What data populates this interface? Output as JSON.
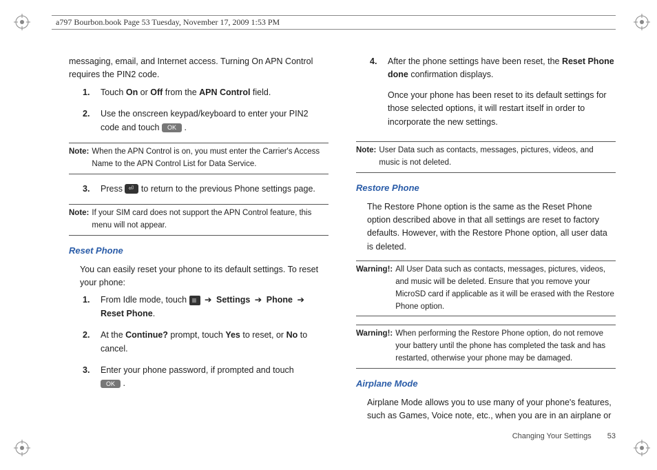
{
  "header": "a797 Bourbon.book  Page 53  Tuesday, November 17, 2009  1:53 PM",
  "left": {
    "intro": "messaging, email, and Internet access. Turning On APN Control requires the PIN2 code.",
    "steps_a": [
      {
        "n": "1.",
        "pre": "Touch ",
        "b1": "On",
        "mid": " or ",
        "b2": "Off",
        "mid2": " from the ",
        "b3": "APN Control",
        "post": " field."
      },
      {
        "n": "2.",
        "text": "Use the onscreen keypad/keyboard to enter your PIN2 code and touch ",
        "ok": "OK"
      }
    ],
    "note1": {
      "label": "Note:",
      "text": "When the APN Control is on, you must enter the Carrier's Access Name to the APN Control List for Data Service."
    },
    "step3": {
      "n": "3.",
      "pre": "Press ",
      "post": " to return to the previous Phone settings page."
    },
    "note2": {
      "label": "Note:",
      "text": "If your SIM card does not support the APN Control feature, this menu will not appear."
    },
    "h_reset": "Reset Phone",
    "reset_intro": "You can easily reset your phone to its default settings. To reset your phone:",
    "reset_steps": [
      {
        "n": "1.",
        "pre": "From Idle mode, touch ",
        "arrow": "➔",
        "b1": "Settings",
        "b2": "Phone",
        "b3": "Reset Phone",
        "post": "."
      },
      {
        "n": "2.",
        "pre": "At the ",
        "b1": "Continue?",
        "mid": " prompt, touch ",
        "b2": "Yes",
        "mid2": " to reset, or ",
        "b3": "No",
        "post": " to cancel."
      },
      {
        "n": "3.",
        "text": "Enter your phone password, if prompted and touch ",
        "ok": "OK"
      }
    ]
  },
  "right": {
    "step4": {
      "n": "4.",
      "pre": "After the phone settings have been reset, the ",
      "b1": "Reset Phone done",
      "mid": " confirmation displays.",
      "para2": "Once your phone has been reset to its default settings for those selected options, it will restart itself in order to incorporate the new settings."
    },
    "note3": {
      "label": "Note:",
      "text": "User Data such as contacts, messages, pictures, videos, and music is not deleted."
    },
    "h_restore": "Restore Phone",
    "restore_para": "The Restore Phone option is the same as the Reset Phone option described above in that all settings are reset to factory defaults. However, with the Restore Phone option, all user data is deleted.",
    "warn1": {
      "label": "Warning!:",
      "text": "All User Data such as contacts, messages, pictures, videos, and music will be deleted. Ensure that you remove your MicroSD card if applicable as it will be erased with the Restore Phone option."
    },
    "warn2": {
      "label": "Warning!:",
      "text": "When performing the Restore Phone option, do not remove your battery until the phone has completed the task and has restarted, otherwise your phone may be damaged."
    },
    "h_airplane": "Airplane Mode",
    "airplane_para": "Airplane Mode allows you to use many of your phone's features, such as Games, Voice note, etc., when you are in an airplane or"
  },
  "footer": {
    "section": "Changing Your Settings",
    "page": "53"
  }
}
